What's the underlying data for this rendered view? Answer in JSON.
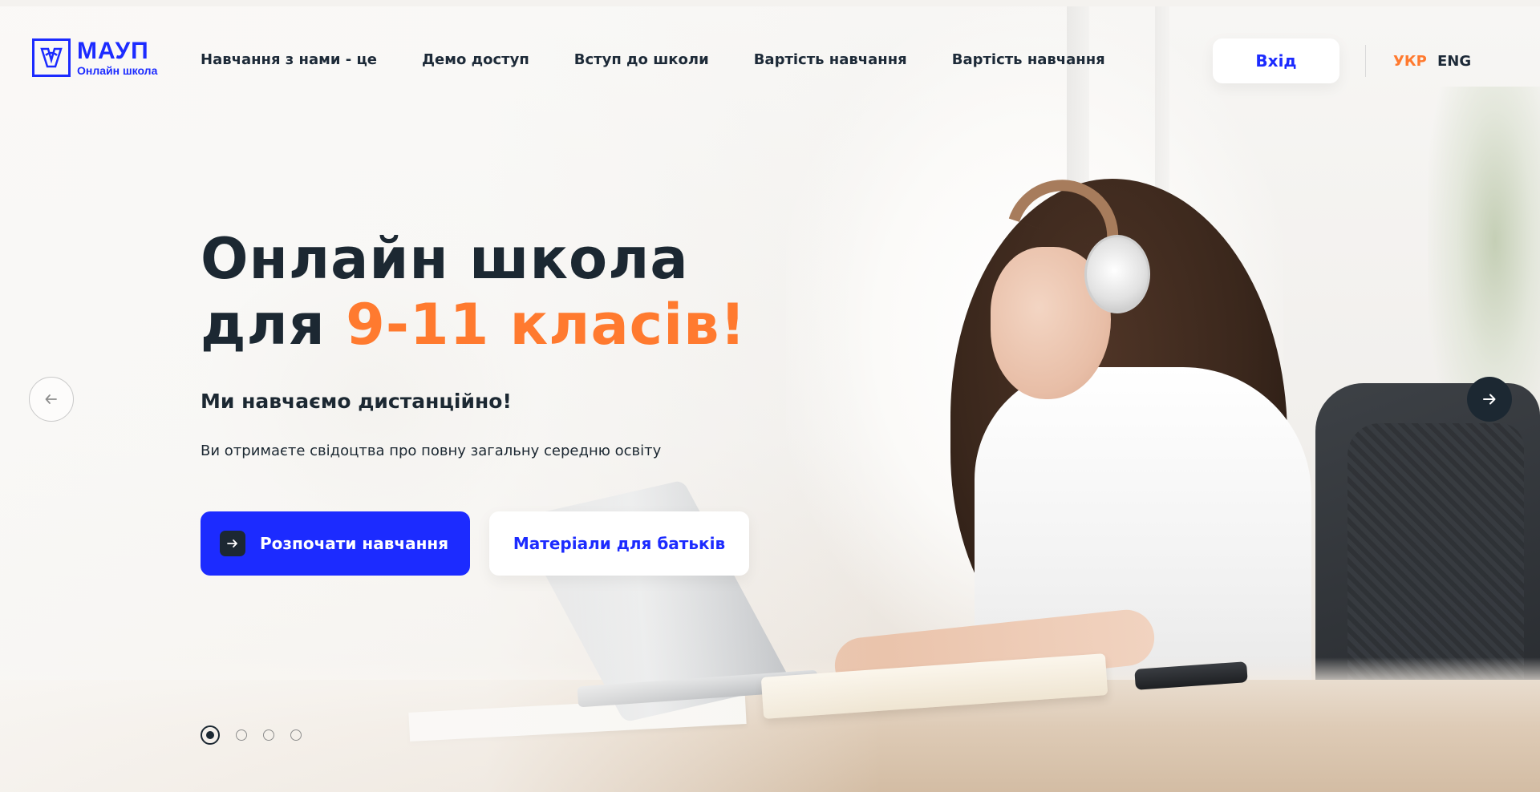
{
  "header": {
    "logo": {
      "title": "МАУП",
      "subtitle": "Онлайн школа"
    },
    "nav": [
      {
        "label": "Навчання з нами - це"
      },
      {
        "label": "Демо доступ"
      },
      {
        "label": "Вступ до школи"
      },
      {
        "label": "Вартість навчання"
      },
      {
        "label": "Вартість навчання"
      }
    ],
    "login_label": "Вхід",
    "languages": {
      "active": "УКР",
      "other": "ENG"
    }
  },
  "hero": {
    "title_line1": "Онлайн школа",
    "title_line2_prefix": "для ",
    "title_line2_accent": "9-11 класів!",
    "subtitle": "Ми навчаємо дистанційно!",
    "description": "Ви отримаєте свідоцтва про повну загальну середню освіту",
    "primary_button": "Розпочати навчання",
    "secondary_button": "Матеріали для батьків"
  },
  "slider": {
    "slide_count": 4,
    "active_index": 0
  },
  "colors": {
    "brand_blue": "#1c2bff",
    "accent_orange": "#ff7a2f",
    "dark": "#1c2832"
  },
  "icons": {
    "prev": "arrow-left-icon",
    "next": "arrow-right-icon",
    "button": "arrow-right-icon",
    "logo": "maup-logo-icon"
  }
}
